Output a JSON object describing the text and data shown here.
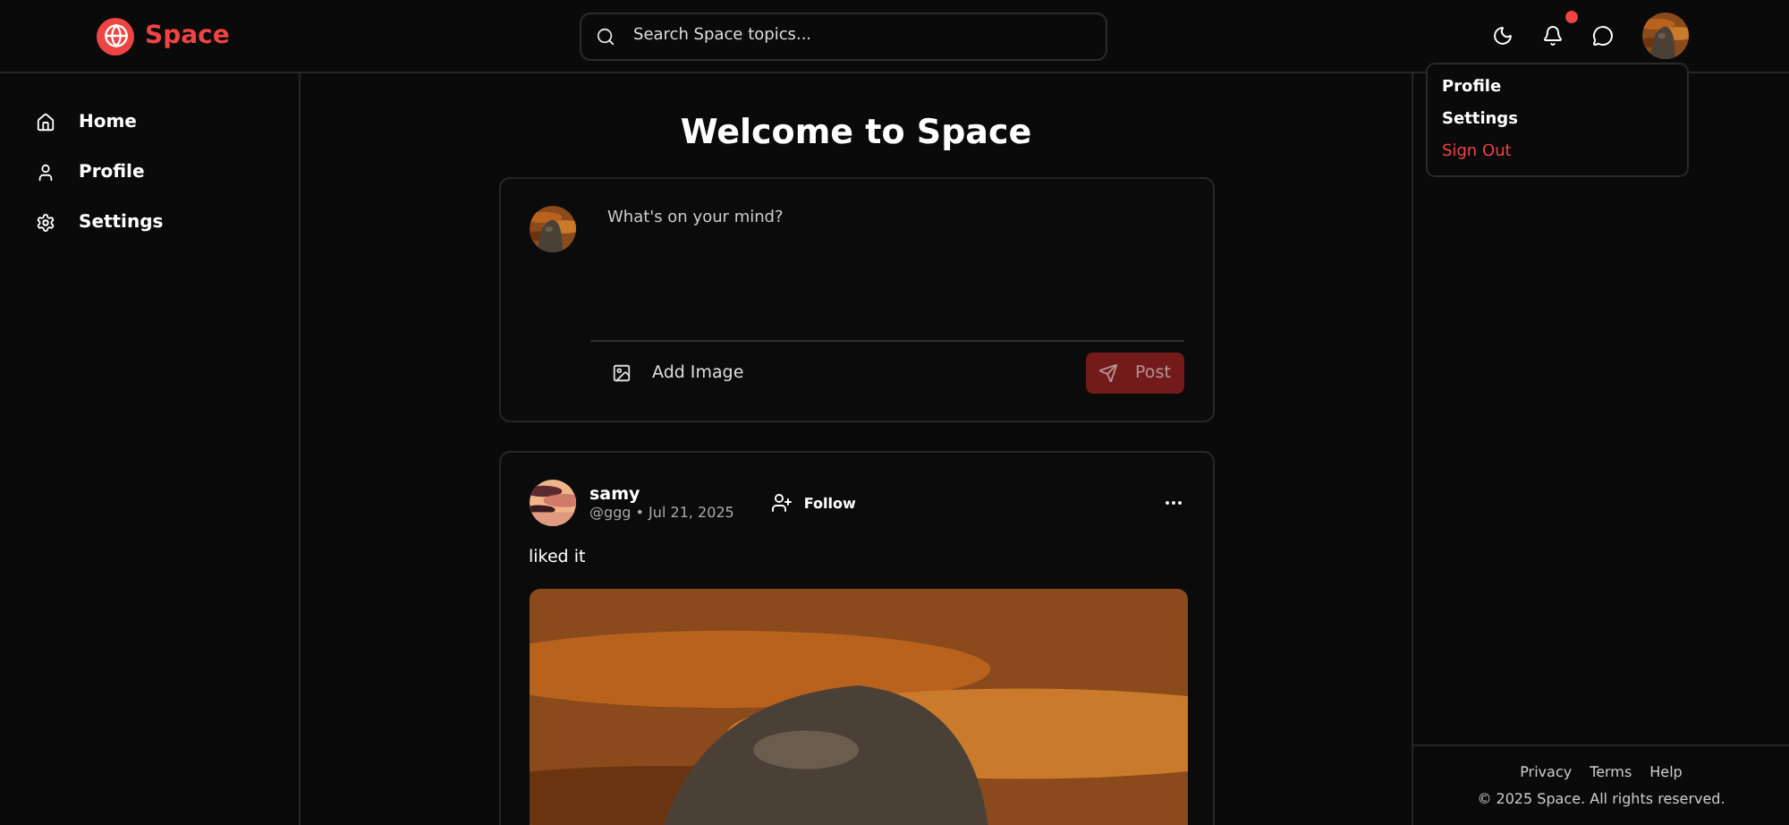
{
  "header": {
    "logo": "Space",
    "search": {
      "placeholder": "Search Space topics..."
    },
    "notifications": {
      "unread": true
    }
  },
  "sidebar": {
    "items": [
      {
        "label": "Home"
      },
      {
        "label": "Profile"
      },
      {
        "label": "Settings"
      }
    ]
  },
  "main": {
    "title": "Welcome to Space",
    "composer": {
      "placeholder": "What's on your mind?",
      "add_image": "Add Image",
      "post_button": {
        "label": "Post",
        "disabled": true
      }
    },
    "posts": [
      {
        "name": "samy",
        "handle": "@ggg",
        "separator": "•",
        "date": "Jul 21, 2025",
        "follow": "Follow",
        "text": "liked it"
      }
    ]
  },
  "user_menu": {
    "items": [
      {
        "label": "Profile",
        "kind": "normal"
      },
      {
        "label": "Settings",
        "kind": "normal"
      },
      {
        "label": "Sign Out",
        "kind": "danger"
      }
    ]
  },
  "footer": {
    "links": [
      "Privacy",
      "Terms",
      "Help"
    ],
    "copyright": "© 2025 Space. All rights reserved."
  }
}
